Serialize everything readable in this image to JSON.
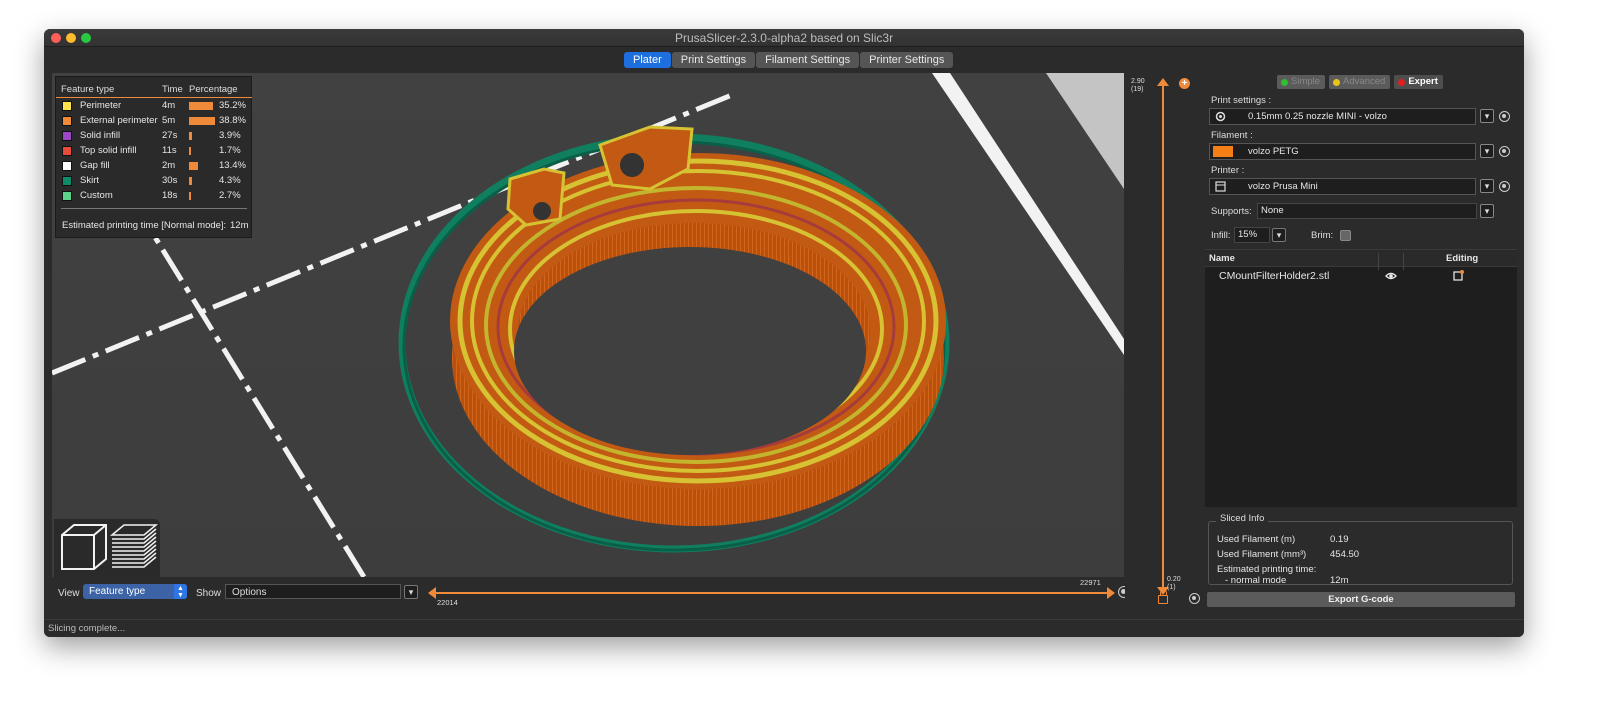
{
  "window": {
    "title": "PrusaSlicer-2.3.0-alpha2 based on Slic3r"
  },
  "tabs": [
    {
      "label": "Plater",
      "active": true
    },
    {
      "label": "Print Settings",
      "active": false
    },
    {
      "label": "Filament Settings",
      "active": false
    },
    {
      "label": "Printer Settings",
      "active": false
    }
  ],
  "legend": {
    "headers": {
      "feature": "Feature type",
      "time": "Time",
      "percentage": "Percentage"
    },
    "rows": [
      {
        "name": "Perimeter",
        "time": "4m",
        "percent": "35.2%",
        "value": 35.2,
        "color": "#ffe34d"
      },
      {
        "name": "External perimeter",
        "time": "5m",
        "percent": "38.8%",
        "value": 38.8,
        "color": "#f08a3b"
      },
      {
        "name": "Solid infill",
        "time": "27s",
        "percent": "3.9%",
        "value": 3.9,
        "color": "#9b47c7"
      },
      {
        "name": "Top solid infill",
        "time": "11s",
        "percent": "1.7%",
        "value": 1.7,
        "color": "#e84b3c"
      },
      {
        "name": "Gap fill",
        "time": "2m",
        "percent": "13.4%",
        "value": 13.4,
        "color": "#ffffff"
      },
      {
        "name": "Skirt",
        "time": "30s",
        "percent": "4.3%",
        "value": 4.3,
        "color": "#0f8b6a"
      },
      {
        "name": "Custom",
        "time": "18s",
        "percent": "2.7%",
        "value": 2.7,
        "color": "#5cd28a"
      }
    ],
    "estimated_label": "Estimated printing time [Normal mode]:",
    "estimated_value": "12m"
  },
  "bottom": {
    "view_label": "View",
    "view_value": "Feature type",
    "show_label": "Show",
    "show_value": "Options",
    "slider_top_value": "22971",
    "slider_bottom_value": "22014"
  },
  "vslider": {
    "top_height": "2.90",
    "top_layer": "(19)",
    "bottom_height": "0.20",
    "bottom_layer": "(1)"
  },
  "sidebar": {
    "modes": [
      {
        "label": "Simple",
        "color": "#2fbf2f",
        "active": false
      },
      {
        "label": "Advanced",
        "color": "#e6c516",
        "active": false
      },
      {
        "label": "Expert",
        "color": "#e02020",
        "active": true
      }
    ],
    "print_settings_label": "Print settings :",
    "print_settings_value": "0.15mm 0.25 nozzle MINI - volzo",
    "filament_label": "Filament :",
    "filament_value": "volzo PETG",
    "filament_color": "#f57f17",
    "printer_label": "Printer :",
    "printer_value": "volzo Prusa Mini",
    "supports_label": "Supports:",
    "supports_value": "None",
    "infill_label": "Infill:",
    "infill_value": "15%",
    "brim_label": "Brim:",
    "objects": {
      "col_name": "Name",
      "col_editing": "Editing",
      "items": [
        {
          "name": "CMountFilterHolder2.stl"
        }
      ]
    },
    "sliced_info": {
      "title": "Sliced Info",
      "used_filament_m_label": "Used Filament (m)",
      "used_filament_m_value": "0.19",
      "used_filament_mm3_label": "Used Filament (mm³)",
      "used_filament_mm3_value": "454.50",
      "est_time_label": "Estimated printing time:",
      "normal_mode_label": "- normal mode",
      "normal_mode_value": "12m"
    },
    "export_label": "Export G-code"
  },
  "status": {
    "text": "Slicing complete..."
  }
}
